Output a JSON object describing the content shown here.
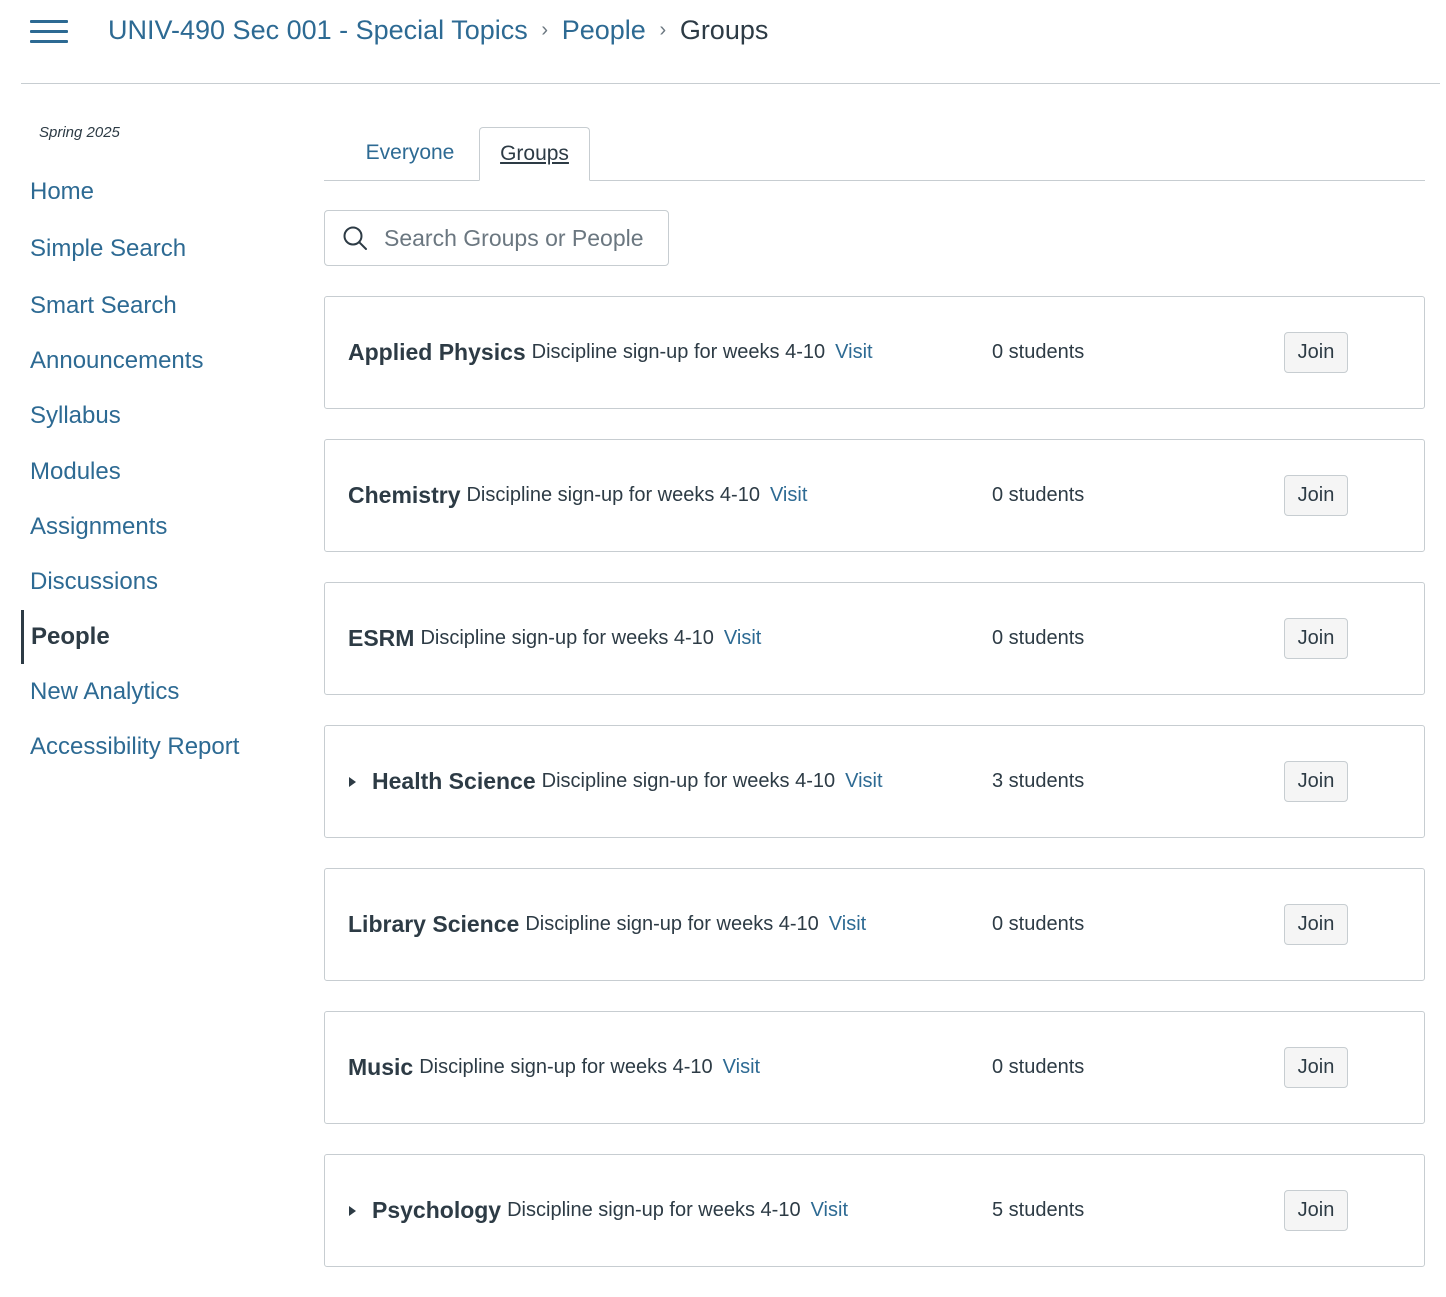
{
  "header": {
    "menu_icon": "hamburger-menu-icon",
    "breadcrumb": [
      {
        "label": "UNIV-490 Sec 001 - Special Topics",
        "link": true
      },
      {
        "label": "People",
        "link": true
      },
      {
        "label": "Groups",
        "link": false
      }
    ],
    "separator": "›"
  },
  "sidebar": {
    "term": "Spring 2025",
    "items": [
      {
        "label": "Home",
        "active": false
      },
      {
        "label": "Simple Search",
        "active": false
      },
      {
        "label": "Smart Search",
        "active": false
      },
      {
        "label": "Announcements",
        "active": false
      },
      {
        "label": "Syllabus",
        "active": false
      },
      {
        "label": "Modules",
        "active": false
      },
      {
        "label": "Assignments",
        "active": false
      },
      {
        "label": "Discussions",
        "active": false
      },
      {
        "label": "People",
        "active": true
      },
      {
        "label": "New Analytics",
        "active": false
      },
      {
        "label": "Accessibility Report",
        "active": false
      }
    ]
  },
  "tabs": {
    "everyone": "Everyone",
    "groups": "Groups",
    "selected": "groups"
  },
  "search": {
    "icon": "search-icon",
    "placeholder": "Search Groups or People",
    "value": ""
  },
  "groups": [
    {
      "name": "Applied Physics",
      "description": "Discipline sign-up for weeks 4-10",
      "visit_label": "Visit",
      "count": "0 students",
      "join_label": "Join",
      "expandable": false
    },
    {
      "name": "Chemistry",
      "description": "Discipline sign-up for weeks 4-10",
      "visit_label": "Visit",
      "count": "0 students",
      "join_label": "Join",
      "expandable": false
    },
    {
      "name": "ESRM",
      "description": "Discipline sign-up for weeks 4-10",
      "visit_label": "Visit",
      "count": "0 students",
      "join_label": "Join",
      "expandable": false
    },
    {
      "name": "Health Science",
      "description": "Discipline sign-up for weeks 4-10",
      "visit_label": "Visit",
      "count": "3 students",
      "join_label": "Join",
      "expandable": true
    },
    {
      "name": "Library Science",
      "description": "Discipline sign-up for weeks 4-10",
      "visit_label": "Visit",
      "count": "0 students",
      "join_label": "Join",
      "expandable": false
    },
    {
      "name": "Music",
      "description": "Discipline sign-up for weeks 4-10",
      "visit_label": "Visit",
      "count": "0 students",
      "join_label": "Join",
      "expandable": false
    },
    {
      "name": "Psychology",
      "description": "Discipline sign-up for weeks 4-10",
      "visit_label": "Visit",
      "count": "5 students",
      "join_label": "Join",
      "expandable": true
    }
  ],
  "colors": {
    "link": "#2d6a93",
    "text": "#2d3b45",
    "border": "#c7cdd1",
    "button_bg": "#f5f5f5"
  }
}
